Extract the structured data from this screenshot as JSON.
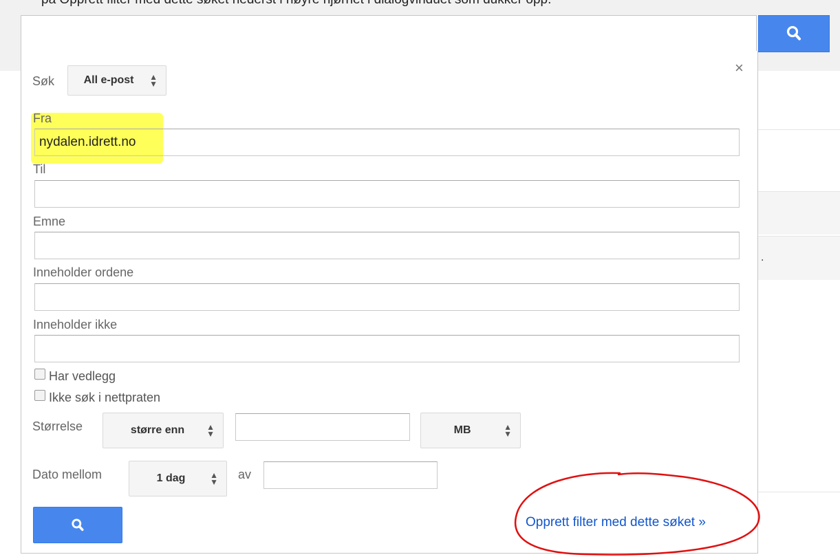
{
  "top_caption": "på Opprett filter med dette søket nederst i høyre hjørnet i dialogvinduet som dukker opp.",
  "search": {
    "value": "",
    "button_icon": "search-icon"
  },
  "dialog": {
    "close_label": "×",
    "scope": {
      "label": "Søk",
      "selected": "All e-post"
    },
    "fields": {
      "from": {
        "label": "Fra",
        "value": "nydalen.idrett.no"
      },
      "to": {
        "label": "Til",
        "value": ""
      },
      "subject": {
        "label": "Emne",
        "value": ""
      },
      "has_words": {
        "label": "Inneholder ordene",
        "value": ""
      },
      "no_words": {
        "label": "Inneholder ikke",
        "value": ""
      }
    },
    "has_attachment": {
      "label": "Har vedlegg",
      "checked": false
    },
    "no_chat": {
      "label": "Ikke søk i nettpraten",
      "checked": false
    },
    "size": {
      "label": "Størrelse",
      "operator": "større enn",
      "value": "",
      "unit": "MB"
    },
    "date": {
      "label": "Dato mellom",
      "range": "1 dag",
      "av_label": "av",
      "value": ""
    },
    "submit_icon": "search-icon",
    "create_filter_link": "Opprett filter med dette søket »"
  },
  "colors": {
    "accent": "#4787ed",
    "link": "#1155cc",
    "highlight": "#ffff3d",
    "annotation": "#e01010"
  }
}
